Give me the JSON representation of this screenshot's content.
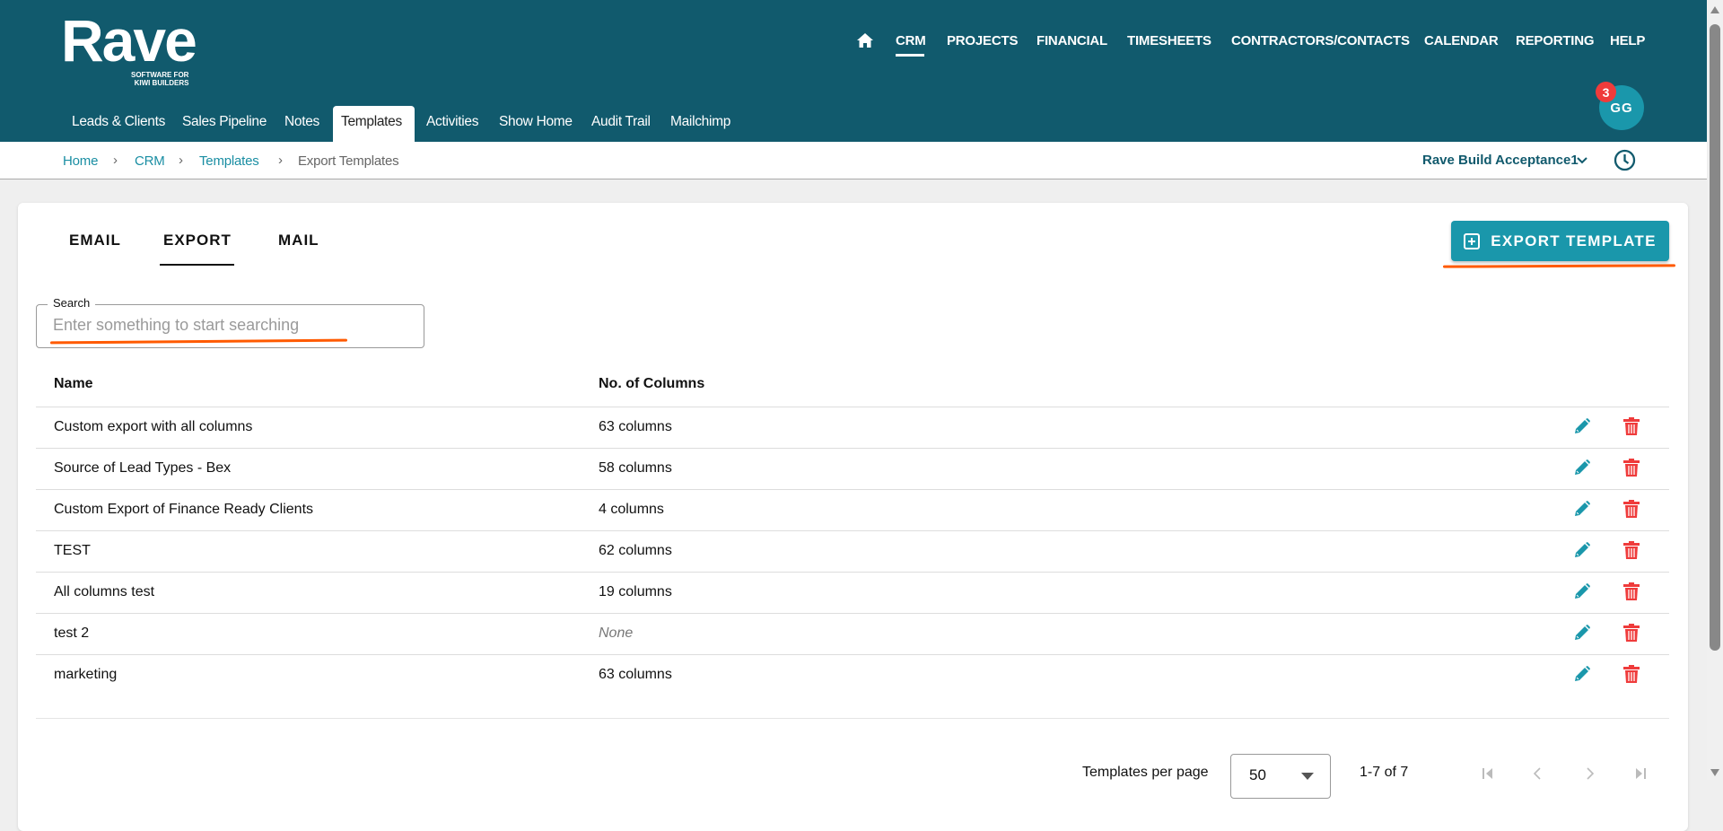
{
  "logo": {
    "name": "Rave",
    "tagline_1": "SOFTWARE FOR",
    "tagline_2": "KIWI BUILDERS"
  },
  "top_nav": [
    "CRM",
    "PROJECTS",
    "FINANCIAL",
    "TIMESHEETS",
    "CONTRACTORS/CONTACTS",
    "CALENDAR",
    "REPORTING",
    "HELP"
  ],
  "sub_nav": [
    "Leads & Clients",
    "Sales Pipeline",
    "Notes",
    "Templates",
    "Activities",
    "Show Home",
    "Audit Trail",
    "Mailchimp"
  ],
  "user": {
    "initials": "GG",
    "notifications": "3"
  },
  "breadcrumb": [
    "Home",
    "CRM",
    "Templates",
    "Export Templates"
  ],
  "company": "Rave Build Acceptance1",
  "tabs": [
    "EMAIL",
    "EXPORT",
    "MAIL"
  ],
  "export_button": "EXPORT TEMPLATE",
  "search": {
    "label": "Search",
    "placeholder": "Enter something to start searching"
  },
  "table": {
    "headers": [
      "Name",
      "No. of Columns"
    ],
    "rows": [
      {
        "name": "Custom export with all columns",
        "columns": "63 columns"
      },
      {
        "name": "Source of Lead Types - Bex",
        "columns": "58 columns"
      },
      {
        "name": "Custom Export of Finance Ready Clients",
        "columns": "4 columns"
      },
      {
        "name": "TEST",
        "columns": "62 columns"
      },
      {
        "name": "All columns test",
        "columns": "19 columns"
      },
      {
        "name": "test 2",
        "columns": "None"
      },
      {
        "name": "marketing",
        "columns": "63 columns"
      }
    ]
  },
  "pagination": {
    "label": "Templates per page",
    "per_page": "50",
    "range": "1-7 of 7"
  },
  "colors": {
    "header": "#115a6d",
    "accent": "#1a97ab",
    "delete": "#ef3b3b",
    "annotation": "#ff5a00"
  }
}
